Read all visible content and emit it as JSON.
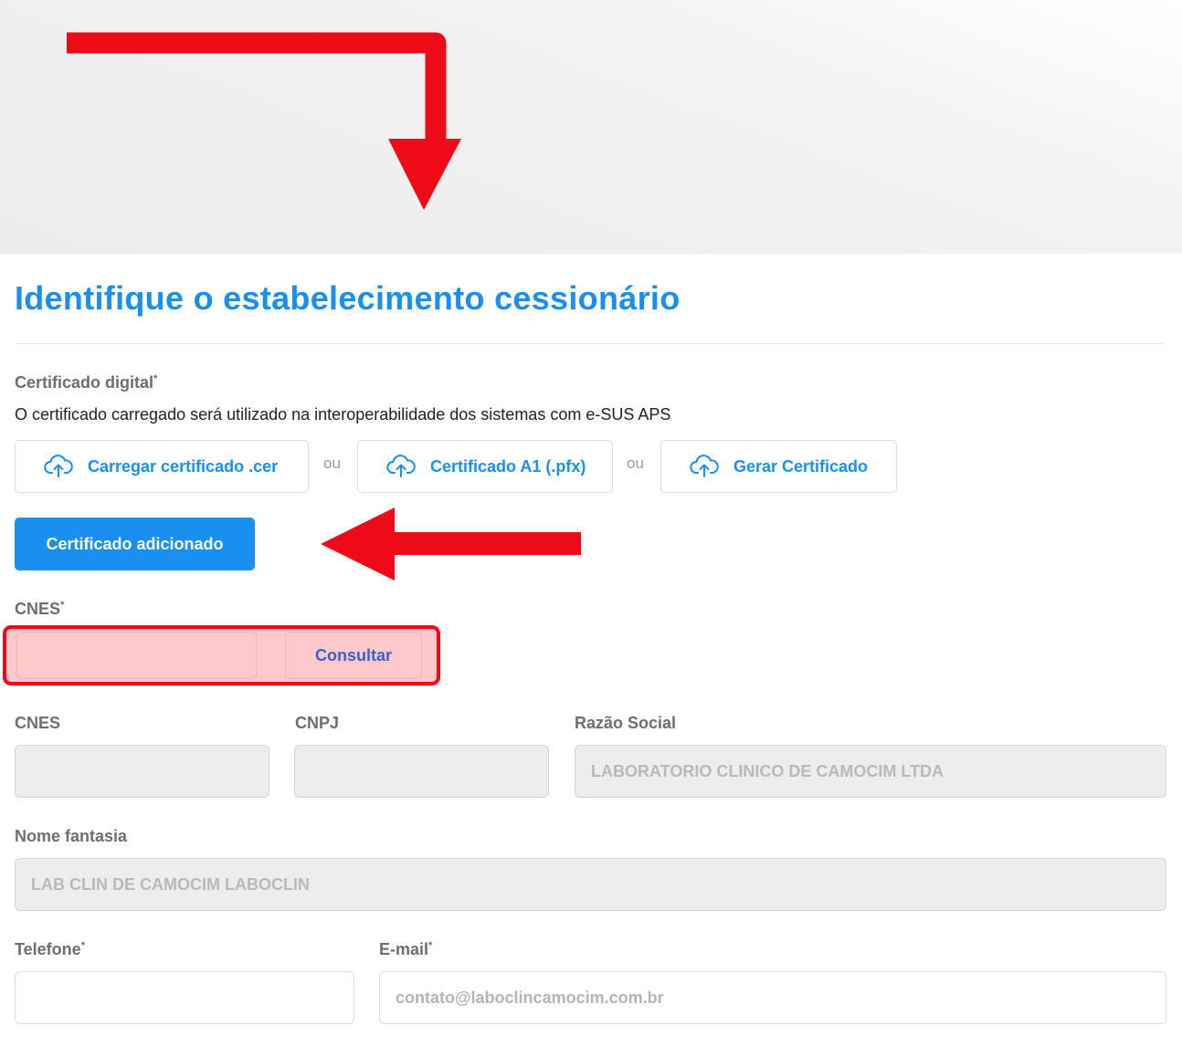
{
  "page": {
    "title": "Identifique o estabelecimento cessionário"
  },
  "certificate": {
    "label": "Certificado digital",
    "required_mark": "*",
    "description": "O certificado carregado será utilizado na interoperabilidade dos sistemas com e-SUS APS",
    "buttons": [
      {
        "label": "Carregar certificado .cer",
        "icon": "cloud-upload-icon"
      },
      {
        "label": "Certificado A1 (.pfx)",
        "icon": "cloud-upload-icon"
      },
      {
        "label": "Gerar Certificado",
        "icon": "cloud-upload-icon"
      }
    ],
    "separator": "ou",
    "added_label": "Certificado adicionado"
  },
  "cnes_search": {
    "label": "CNES",
    "required_mark": "*",
    "value": "",
    "button_label": "Consultar"
  },
  "details": {
    "cnes": {
      "label": "CNES",
      "value": ""
    },
    "cnpj": {
      "label": "CNPJ",
      "value": ""
    },
    "razao_social": {
      "label": "Razão Social",
      "value": "LABORATORIO CLINICO DE CAMOCIM LTDA"
    },
    "nome_fantasia": {
      "label": "Nome fantasia",
      "value": "LAB CLIN DE CAMOCIM LABOCLIN"
    },
    "telefone": {
      "label": "Telefone",
      "required_mark": "*",
      "value": ""
    },
    "email": {
      "label": "E-mail",
      "required_mark": "*",
      "value": "contato@laboclincamocim.com.br"
    }
  },
  "colors": {
    "primary": "#1b8ff0",
    "annotation_red": "#ee0a16",
    "highlight_fill": "#ffc8ca"
  }
}
